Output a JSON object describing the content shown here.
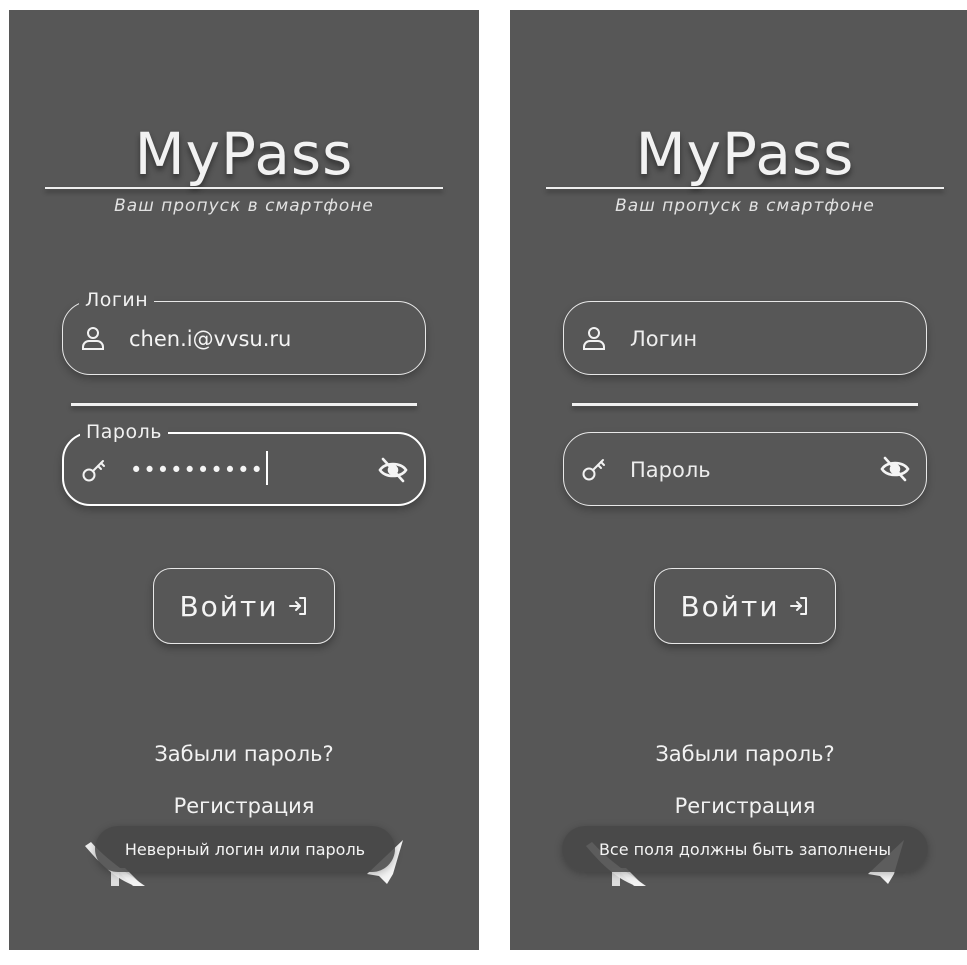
{
  "colors": {
    "page_background": "#ffffff",
    "screen_background": "#575757",
    "foreground": "#f2f2f2"
  },
  "screens": [
    {
      "app_title": "MyPass",
      "subtitle": "Ваш пропуск в смартфоне",
      "login_field": {
        "legend": "Логин",
        "value": "chen.i@vvsu.ru",
        "icon": "user-icon"
      },
      "password_field": {
        "legend": "Пароль",
        "value": "••••••••••",
        "icon": "key-icon",
        "toggle_icon": "eye-off-icon"
      },
      "login_button": {
        "label": "Войти",
        "icon": "login-arrow-icon"
      },
      "forgot_password_link": "Забыли пароль?",
      "register_link": "Регистрация",
      "social_icons": [
        "vk-icon",
        "telegram-icon"
      ],
      "toast": "Неверный логин или пароль"
    },
    {
      "app_title": "MyPass",
      "subtitle": "Ваш пропуск в смартфоне",
      "login_field": {
        "placeholder": "Логин",
        "icon": "user-icon"
      },
      "password_field": {
        "placeholder": "Пароль",
        "icon": "key-icon",
        "toggle_icon": "eye-off-icon"
      },
      "login_button": {
        "label": "Войти",
        "icon": "login-arrow-icon"
      },
      "forgot_password_link": "Забыли пароль?",
      "register_link": "Регистрация",
      "social_icons": [
        "vk-icon",
        "telegram-icon"
      ],
      "toast": "Все поля должны быть заполнены"
    }
  ]
}
